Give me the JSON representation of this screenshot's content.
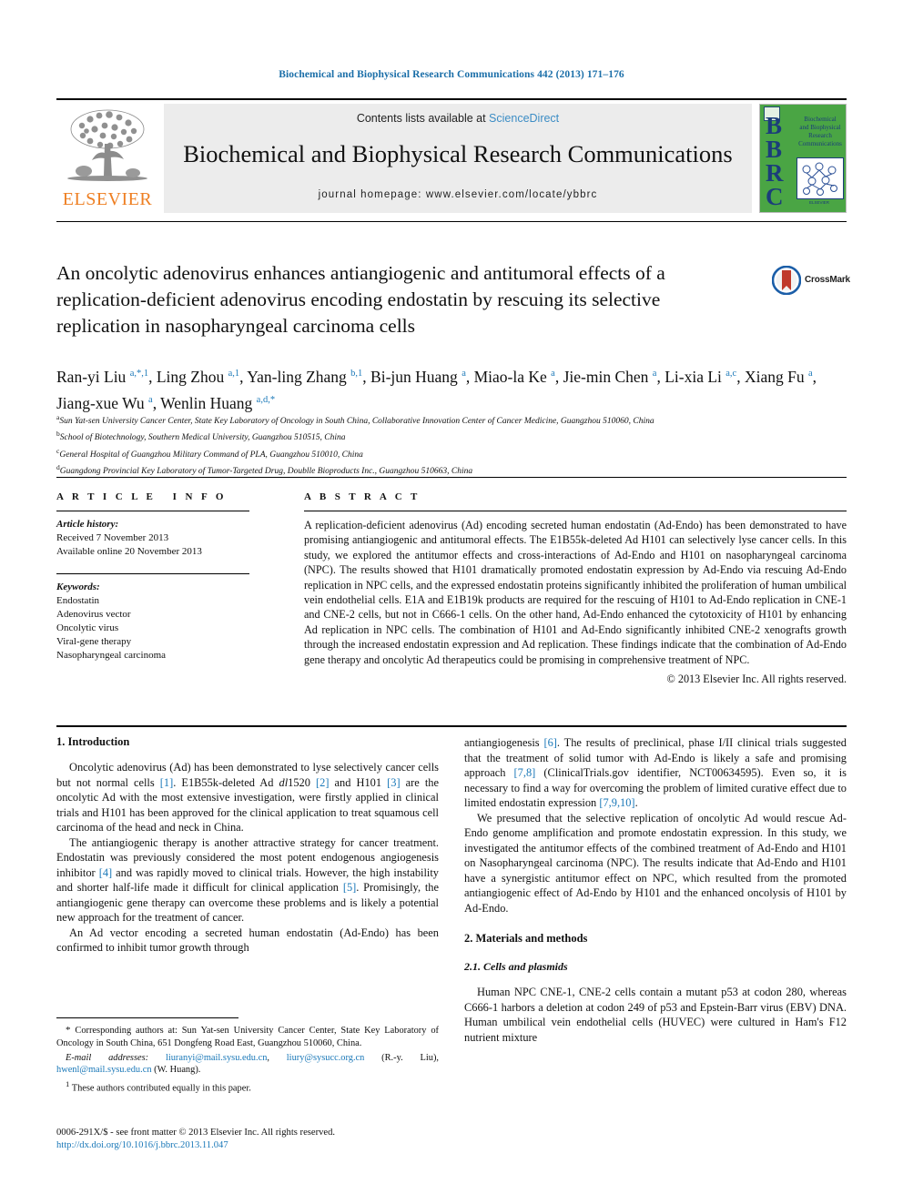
{
  "running_head": "Biochemical and Biophysical Research Communications 442 (2013) 171–176",
  "banner": {
    "contents_prefix": "Contents lists available at ",
    "sciencedirect": "ScienceDirect",
    "journal_title": "Biochemical and Biophysical Research Communications",
    "homepage": "journal homepage: www.elsevier.com/locate/ybbrc",
    "elsevier_wordmark": "ELSEVIER",
    "cover": {
      "letters": "BBRC",
      "title_lines": "Biochemical and Biophysical Research Communications",
      "bottom_text": "ELSEVIER"
    }
  },
  "title": "An oncolytic adenovirus enhances antiangiogenic and antitumoral effects of a replication-deficient adenovirus encoding endostatin by rescuing its selective replication in nasopharyngeal carcinoma cells",
  "crossmark_label": "CrossMark",
  "authors_html": "Ran-yi Liu <sup>a,*,1</sup>, Ling Zhou <sup>a,1</sup>, Yan-ling Zhang <sup>b,1</sup>, Bi-jun Huang <sup>a</sup>, Miao-la Ke <sup>a</sup>, Jie-min Chen <sup>a</sup>, Li-xia Li <sup>a,c</sup>, Xiang Fu <sup>a</sup>, Jiang-xue Wu <sup>a</sup>, Wenlin Huang <sup>a,d,*</sup>",
  "affiliations": [
    {
      "marker": "a",
      "text": "Sun Yat-sen University Cancer Center, State Key Laboratory of Oncology in South China, Collaborative Innovation Center of Cancer Medicine, Guangzhou 510060, China"
    },
    {
      "marker": "b",
      "text": "School of Biotechnology, Southern Medical University, Guangzhou 510515, China"
    },
    {
      "marker": "c",
      "text": "General Hospital of Guangzhou Military Command of PLA, Guangzhou 510010, China"
    },
    {
      "marker": "d",
      "text": "Guangdong Provincial Key Laboratory of Tumor-Targeted Drug, Doublle Bioproducts Inc., Guangzhou 510663, China"
    }
  ],
  "article_info": {
    "heading": "ARTICLE INFO",
    "history_label": "Article history:",
    "history": [
      "Received 7 November 2013",
      "Available online 20 November 2013"
    ],
    "keywords_label": "Keywords:",
    "keywords": [
      "Endostatin",
      "Adenovirus vector",
      "Oncolytic virus",
      "Viral-gene therapy",
      "Nasopharyngeal carcinoma"
    ]
  },
  "abstract": {
    "heading": "ABSTRACT",
    "text": "A replication-deficient adenovirus (Ad) encoding secreted human endostatin (Ad-Endo) has been demonstrated to have promising antiangiogenic and antitumoral effects. The E1B55k-deleted Ad H101 can selectively lyse cancer cells. In this study, we explored the antitumor effects and cross-interactions of Ad-Endo and H101 on nasopharyngeal carcinoma (NPC). The results showed that H101 dramatically promoted endostatin expression by Ad-Endo via rescuing Ad-Endo replication in NPC cells, and the expressed endostatin proteins significantly inhibited the proliferation of human umbilical vein endothelial cells. E1A and E1B19k products are required for the rescuing of H101 to Ad-Endo replication in CNE-1 and CNE-2 cells, but not in C666-1 cells. On the other hand, Ad-Endo enhanced the cytotoxicity of H101 by enhancing Ad replication in NPC cells. The combination of H101 and Ad-Endo significantly inhibited CNE-2 xenografts growth through the increased endostatin expression and Ad replication. These findings indicate that the combination of Ad-Endo gene therapy and oncolytic Ad therapeutics could be promising in comprehensive treatment of NPC.",
    "copyright": "© 2013 Elsevier Inc. All rights reserved."
  },
  "body": {
    "intro_heading": "1. Introduction",
    "methods_heading": "2. Materials and methods",
    "methods_sub_heading": "2.1. Cells and plasmids",
    "left_paragraphs_html": [
      "Oncolytic adenovirus (Ad) has been demonstrated to lyse selectively cancer cells but not normal cells <span class=\"ref\">[1]</span>. E1B55k-deleted Ad <span class=\"ital\">dl</span>1520 <span class=\"ref\">[2]</span> and H101 <span class=\"ref\">[3]</span> are the oncolytic Ad with the most extensive investigation, were firstly applied in clinical trials and H101 has been approved for the clinical application to treat squamous cell carcinoma of the head and neck in China.",
      "The antiangiogenic therapy is another attractive strategy for cancer treatment. Endostatin was previously considered the most potent endogenous angiogenesis inhibitor <span class=\"ref\">[4]</span> and was rapidly moved to clinical trials. However, the high instability and shorter half-life made it difficult for clinical application <span class=\"ref\">[5]</span>. Promisingly, the antiangiogenic gene therapy can overcome these problems and is likely a potential new approach for the treatment of cancer.",
      "An Ad vector encoding a secreted human endostatin (Ad-Endo) has been confirmed to inhibit tumor growth through"
    ],
    "right_paragraphs_html": [
      "antiangiogenesis <span class=\"ref\">[6]</span>. The results of preclinical, phase I/II clinical trials suggested that the treatment of solid tumor with Ad-Endo is likely a safe and promising approach <span class=\"ref\">[7,8]</span> (ClinicalTrials.gov identifier, NCT00634595). Even so, it is necessary to find a way for overcoming the problem of limited curative effect due to limited endostatin expression <span class=\"ref\">[7,9,10]</span>.",
      "We presumed that the selective replication of oncolytic Ad would rescue Ad-Endo genome amplification and promote endostatin expression. In this study, we investigated the antitumor effects of the combined treatment of Ad-Endo and H101 on Nasopharyngeal carcinoma (NPC). The results indicate that Ad-Endo and H101 have a synergistic antitumor effect on NPC, which resulted from the promoted antiangiogenic effect of Ad-Endo by H101 and the enhanced oncolysis of H101 by Ad-Endo."
    ],
    "methods_paragraph_html": "Human NPC CNE-1, CNE-2 cells contain a mutant p53 at codon 280, whereas C666-1 harbors a deletion at codon 249 of p53 and Epstein-Barr virus (EBV) DNA. Human umbilical vein endothelial cells (HUVEC) were cultured in Ham's F12 nutrient mixture"
  },
  "footnotes": {
    "corresponding_html": "<span style=\"font-size:11px\">*</span> Corresponding authors at: Sun Yat-sen University Cancer Center, State Key Laboratory of Oncology in South China, 651 Dongfeng Road East, Guangzhou 510060, China.",
    "email_html": "<span class=\"email-lbl\">E-mail addresses:</span> <span class=\"link\">liuranyi@mail.sysu.edu.cn</span>, <span class=\"link\">liury@sysucc.org.cn</span> (R.-y. Liu), <span class=\"link\">hwenl@mail.sysu.edu.cn</span> (W. Huang).",
    "equal_html": "<sup>1</sup> These authors contributed equally in this paper."
  },
  "issn": {
    "front_matter": "0006-291X/$ - see front matter © 2013 Elsevier Inc. All rights reserved.",
    "doi": "http://dx.doi.org/10.1016/j.bbrc.2013.11.047"
  }
}
